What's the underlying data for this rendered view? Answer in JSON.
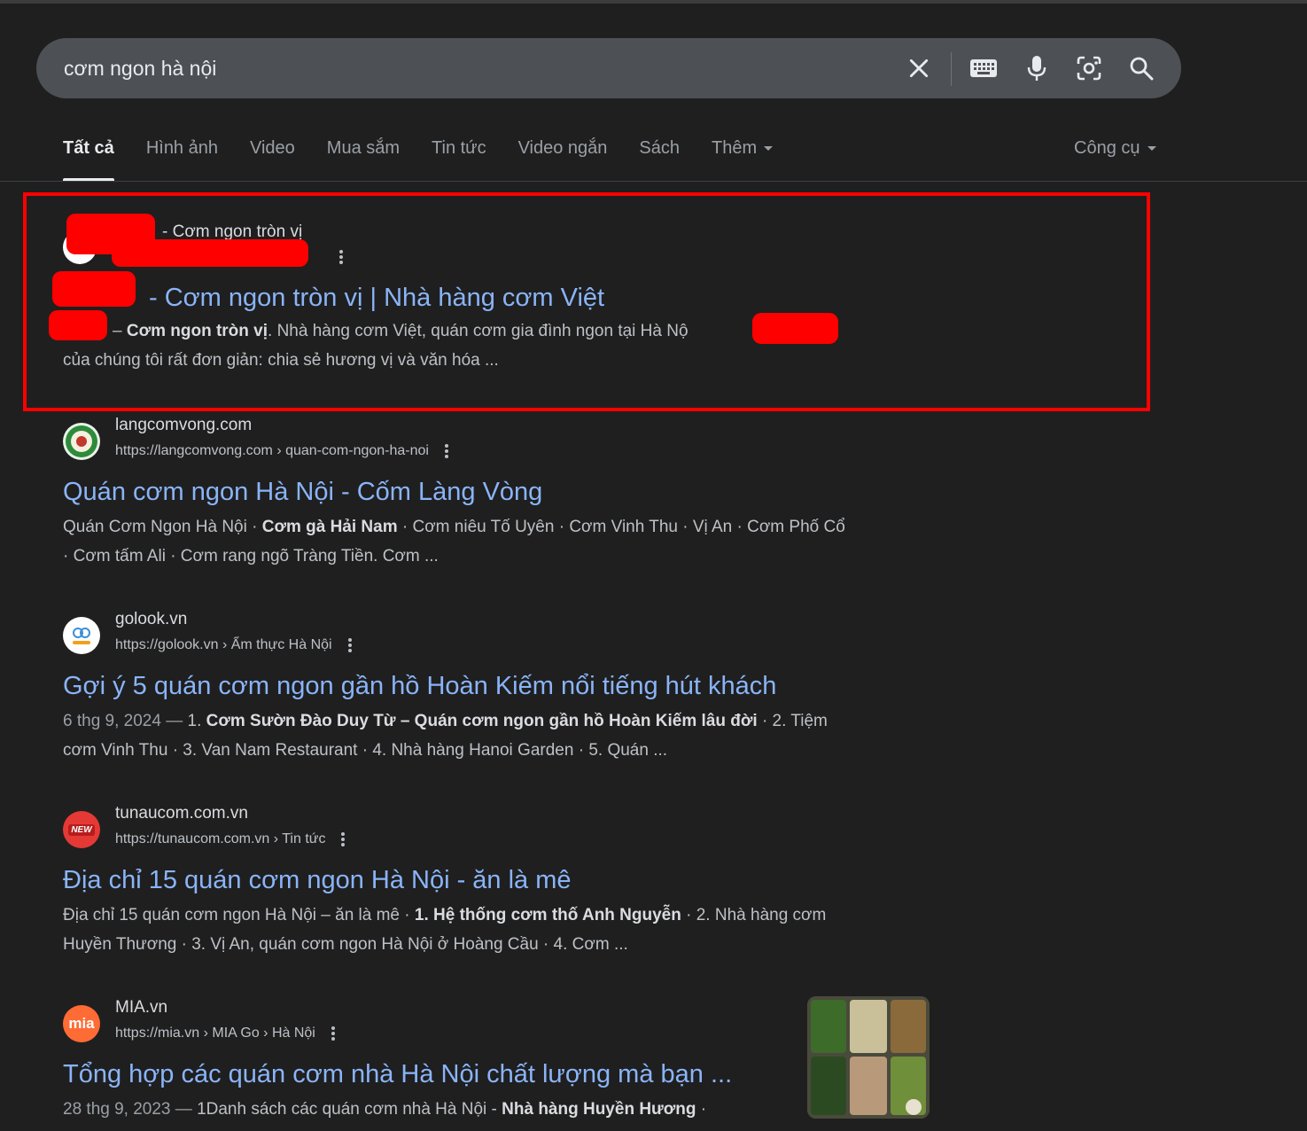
{
  "search": {
    "query": "cơm ngon hà nội",
    "icons": [
      "close-icon",
      "keyboard-icon",
      "microphone-icon",
      "lens-icon",
      "search-icon"
    ]
  },
  "tabs": [
    {
      "label": "Tất cả",
      "active": true
    },
    {
      "label": "Hình ảnh"
    },
    {
      "label": "Video"
    },
    {
      "label": "Mua sắm"
    },
    {
      "label": "Tin tức"
    },
    {
      "label": "Video ngắn"
    },
    {
      "label": "Sách"
    },
    {
      "label": "Thêm"
    }
  ],
  "tools": "Công cụ",
  "results": [
    {
      "site_name": "- Cơm ngon tròn vị",
      "url": "",
      "title": "- Cơm ngon tròn vị | Nhà hàng cơm Việt",
      "snippet_parts": [
        "– ",
        "Cơm ngon tròn vị",
        ". Nhà hàng cơm Việt, quán cơm gia đình ngon tại Hà Nộ",
        ", triết lý",
        "của chúng tôi rất đơn giản: chia sẻ hương vị và văn hóa ..."
      ]
    },
    {
      "site_name": "langcomvong.com",
      "url": "https://langcomvong.com › quan-com-ngon-ha-noi",
      "title": "Quán cơm ngon Hà Nội - Cốm Làng Vòng",
      "snippet_parts": [
        "Quán Cơm Ngon Hà Nội · ",
        "Cơm gà Hải Nam",
        " · Cơm niêu Tố Uyên · Cơm Vinh Thu · Vị An · Cơm Phố Cổ",
        "· Cơm tấm Ali · Cơm rang ngõ Tràng Tiền. Cơm ..."
      ]
    },
    {
      "site_name": "golook.vn",
      "url": "https://golook.vn › Ẩm thực Hà Nội",
      "title": "Gợi ý 5 quán cơm ngon gần hồ Hoàn Kiếm nổi tiếng hút khách",
      "date": "6 thg 9, 2024 — ",
      "snippet_parts": [
        "1. ",
        "Cơm Sườn Đào Duy Từ – Quán cơm ngon gần hồ Hoàn Kiếm lâu đời",
        " · 2. Tiệm",
        "cơm Vinh Thu · 3. Van Nam Restaurant · 4. Nhà hàng Hanoi Garden · 5. Quán ..."
      ]
    },
    {
      "site_name": "tunaucom.com.vn",
      "url": "https://tunaucom.com.vn › Tin tức",
      "title": "Địa chỉ 15 quán cơm ngon Hà Nội - ăn là mê",
      "snippet_parts": [
        "Địa chỉ 15 quán cơm ngon Hà Nội – ăn là mê · ",
        "1. Hệ thống cơm thố Anh Nguyễn",
        " · 2. Nhà hàng cơm",
        "Huyền Thương · 3. Vị An, quán cơm ngon Hà Nội ở Hoàng Cầu · 4. Cơm ..."
      ]
    },
    {
      "site_name": "MIA.vn",
      "url": "https://mia.vn › MIA Go › Hà Nội",
      "title": "Tổng hợp các quán cơm nhà Hà Nội chất lượng mà bạn ...",
      "date": "28 thg 9, 2023 — ",
      "snippet_parts": [
        "1Danh sách các quán cơm nhà Hà Nội - ",
        "Nhà hàng Huyền Hương",
        " ·"
      ]
    }
  ],
  "favicons": {
    "mia_text": "mia",
    "tunau_text": "NEW"
  },
  "colors": {
    "background": "#1f1f1f",
    "link": "#8ab4f8",
    "highlight": "#ff0000",
    "searchbar": "#4d5156"
  }
}
